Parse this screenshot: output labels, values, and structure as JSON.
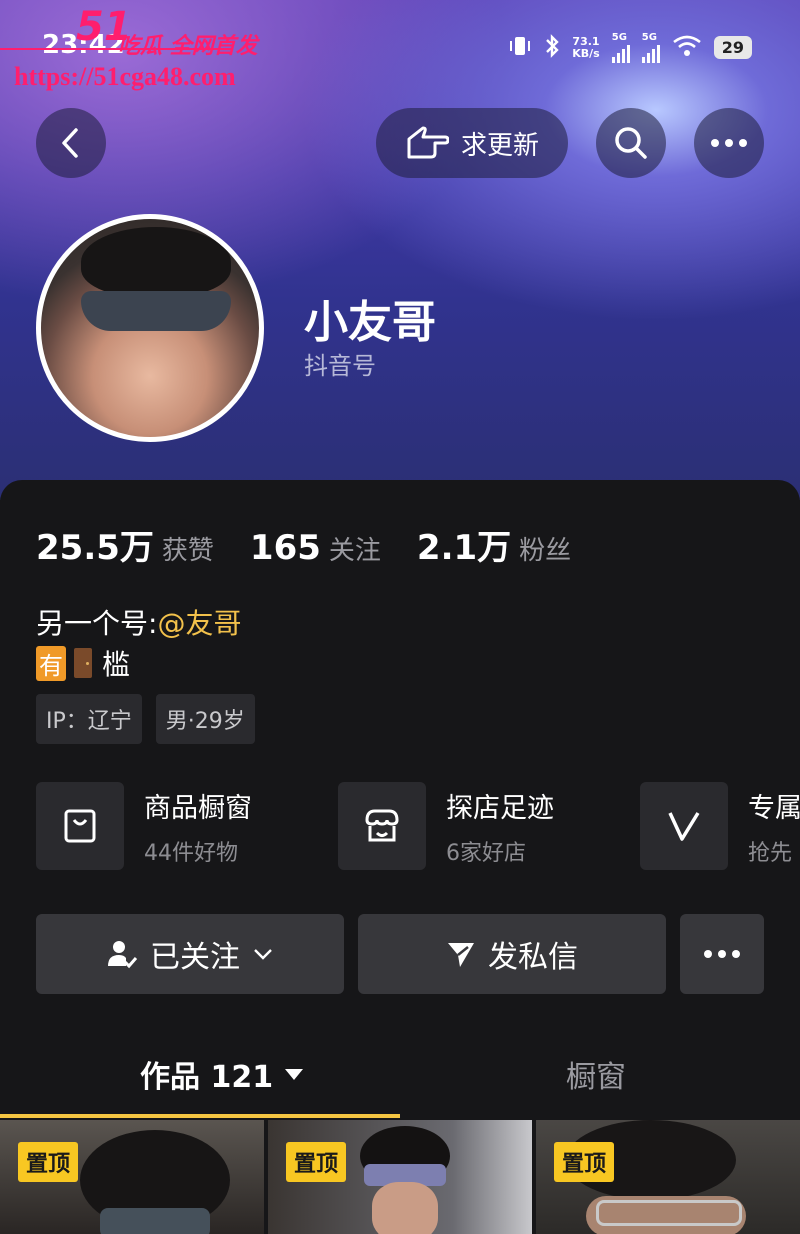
{
  "watermark": {
    "num": "51",
    "text": "吃瓜 全网首发",
    "url": "https://51cga48.com"
  },
  "status_bar": {
    "time": "23:42",
    "speed_value": "73.1",
    "speed_unit": "KB/s",
    "net1": "5G",
    "net2": "5G",
    "battery": "29"
  },
  "top_bar": {
    "update_label": "求更新"
  },
  "profile": {
    "name": "小友哥",
    "id_label": "抖音号"
  },
  "stats": [
    {
      "value": "25.5万",
      "label": "获赞"
    },
    {
      "value": "165",
      "label": "关注"
    },
    {
      "value": "2.1万",
      "label": "粉丝"
    }
  ],
  "bio": {
    "line1_prefix": "另一个号:",
    "line1_mention": "@友哥",
    "line2_tag": "有",
    "line2_text": "槛"
  },
  "chips": {
    "ip": "IP：辽宁",
    "gender_age": "男·29岁"
  },
  "services": [
    {
      "title": "商品橱窗",
      "sub": "44件好物"
    },
    {
      "title": "探店足迹",
      "sub": "6家好店"
    },
    {
      "title": "专属",
      "sub": "抢先"
    }
  ],
  "actions": {
    "follow_label": "已关注",
    "message_label": "发私信"
  },
  "tabs": {
    "works_label": "作品 121",
    "window_label": "橱窗"
  },
  "pin_label": "置顶",
  "colors": {
    "accent": "#f4c542",
    "mention": "#f2c14b",
    "pin": "#f8c722",
    "panel": "#161618"
  }
}
